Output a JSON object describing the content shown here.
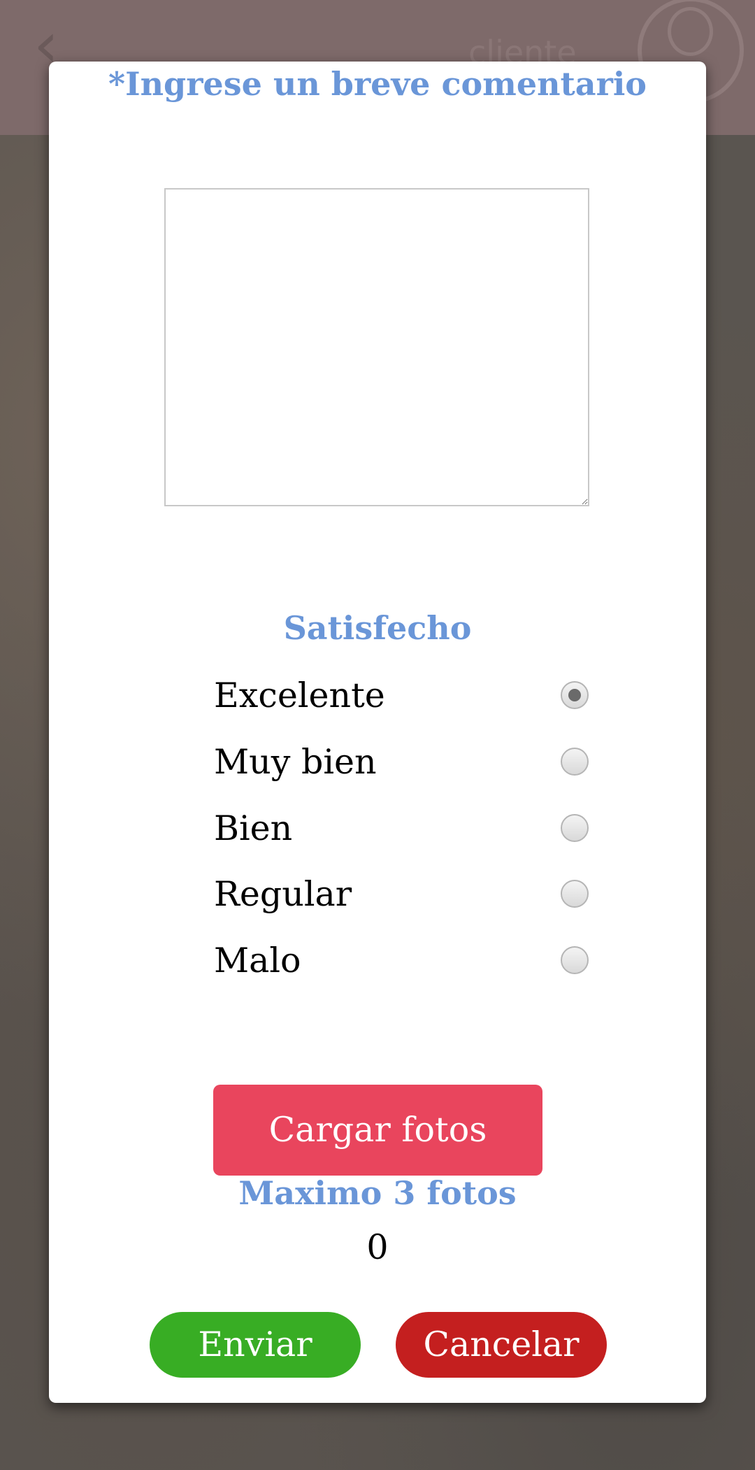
{
  "background": {
    "header_text": "cliente"
  },
  "dialog": {
    "comment_title": "*Ingrese un breve comentario",
    "comment_value": "",
    "rating_title": "Satisfecho",
    "rating_options": [
      {
        "label": "Excelente",
        "selected": true
      },
      {
        "label": "Muy bien",
        "selected": false
      },
      {
        "label": "Bien",
        "selected": false
      },
      {
        "label": "Regular",
        "selected": false
      },
      {
        "label": "Malo",
        "selected": false
      }
    ],
    "upload_label": "Cargar fotos",
    "max_photos_label": "Maximo 3 fotos",
    "photo_count": "0",
    "send_label": "Enviar",
    "cancel_label": "Cancelar"
  },
  "colors": {
    "heading": "#6a96d8",
    "upload": "#e9455d",
    "send": "#38ad24",
    "cancel": "#c41f1f"
  },
  "icons": {
    "back": "chevron-left-icon",
    "profile": "user-icon"
  }
}
